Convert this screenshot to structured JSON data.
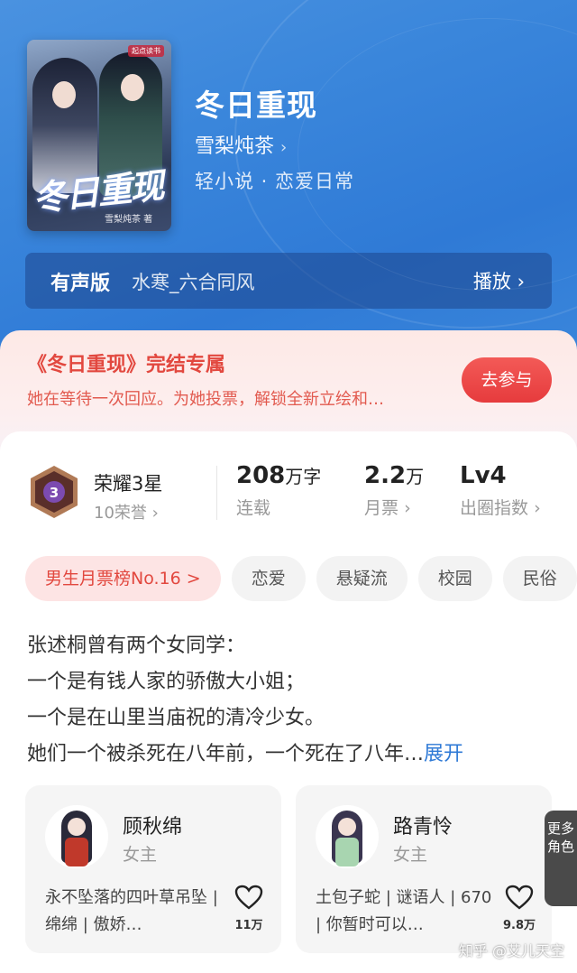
{
  "book": {
    "title": "冬日重现",
    "author": "雪梨炖茶",
    "genre": "轻小说 · 恋爱日常",
    "cover_title": "冬日重现",
    "cover_author": "雪梨炖茶 著",
    "cover_logo": "起点读书"
  },
  "audio": {
    "label": "有声版",
    "narrator": "水寒_六合同风",
    "play_label": "播放"
  },
  "promo": {
    "title": "《冬日重现》完结专属",
    "subtitle": "她在等待一次回应。为她投票，解锁全新立绘和…",
    "button": "去参与"
  },
  "honor": {
    "badge_level": "3",
    "title": "荣耀3星",
    "sub": "10荣誉"
  },
  "stats": [
    {
      "value": "208",
      "unit": "万字",
      "label": "连载"
    },
    {
      "value": "2.2",
      "unit": "万",
      "label": "月票"
    },
    {
      "value": "Lv4",
      "unit": "",
      "label": "出圈指数"
    }
  ],
  "tags": [
    "男生月票榜No.16 >",
    "恋爱",
    "悬疑流",
    "校园",
    "民俗"
  ],
  "synopsis": {
    "lines": [
      "张述桐曾有两个女同学：",
      "一个是有钱人家的骄傲大小姐；",
      "一个是在山里当庙祝的清冷少女。",
      "她们一个被杀死在八年前，一个死在了八年…"
    ],
    "expand": "展开"
  },
  "characters": [
    {
      "name": "顾秋绵",
      "role": "女主",
      "desc": "永不坠落的四叶草吊坠 | 绵绵 | 傲娇…",
      "likes": "11万"
    },
    {
      "name": "路青怜",
      "role": "女主",
      "desc": "土包子蛇 | 谜语人 | 670 | 你暂时可以…",
      "likes": "9.8万"
    }
  ],
  "more_roles": "更多角色",
  "watermark": "知乎 @艾儿天空",
  "colors": {
    "hero": "#3a86db",
    "accent_red": "#e2483f",
    "link_blue": "#2f7ad6"
  }
}
